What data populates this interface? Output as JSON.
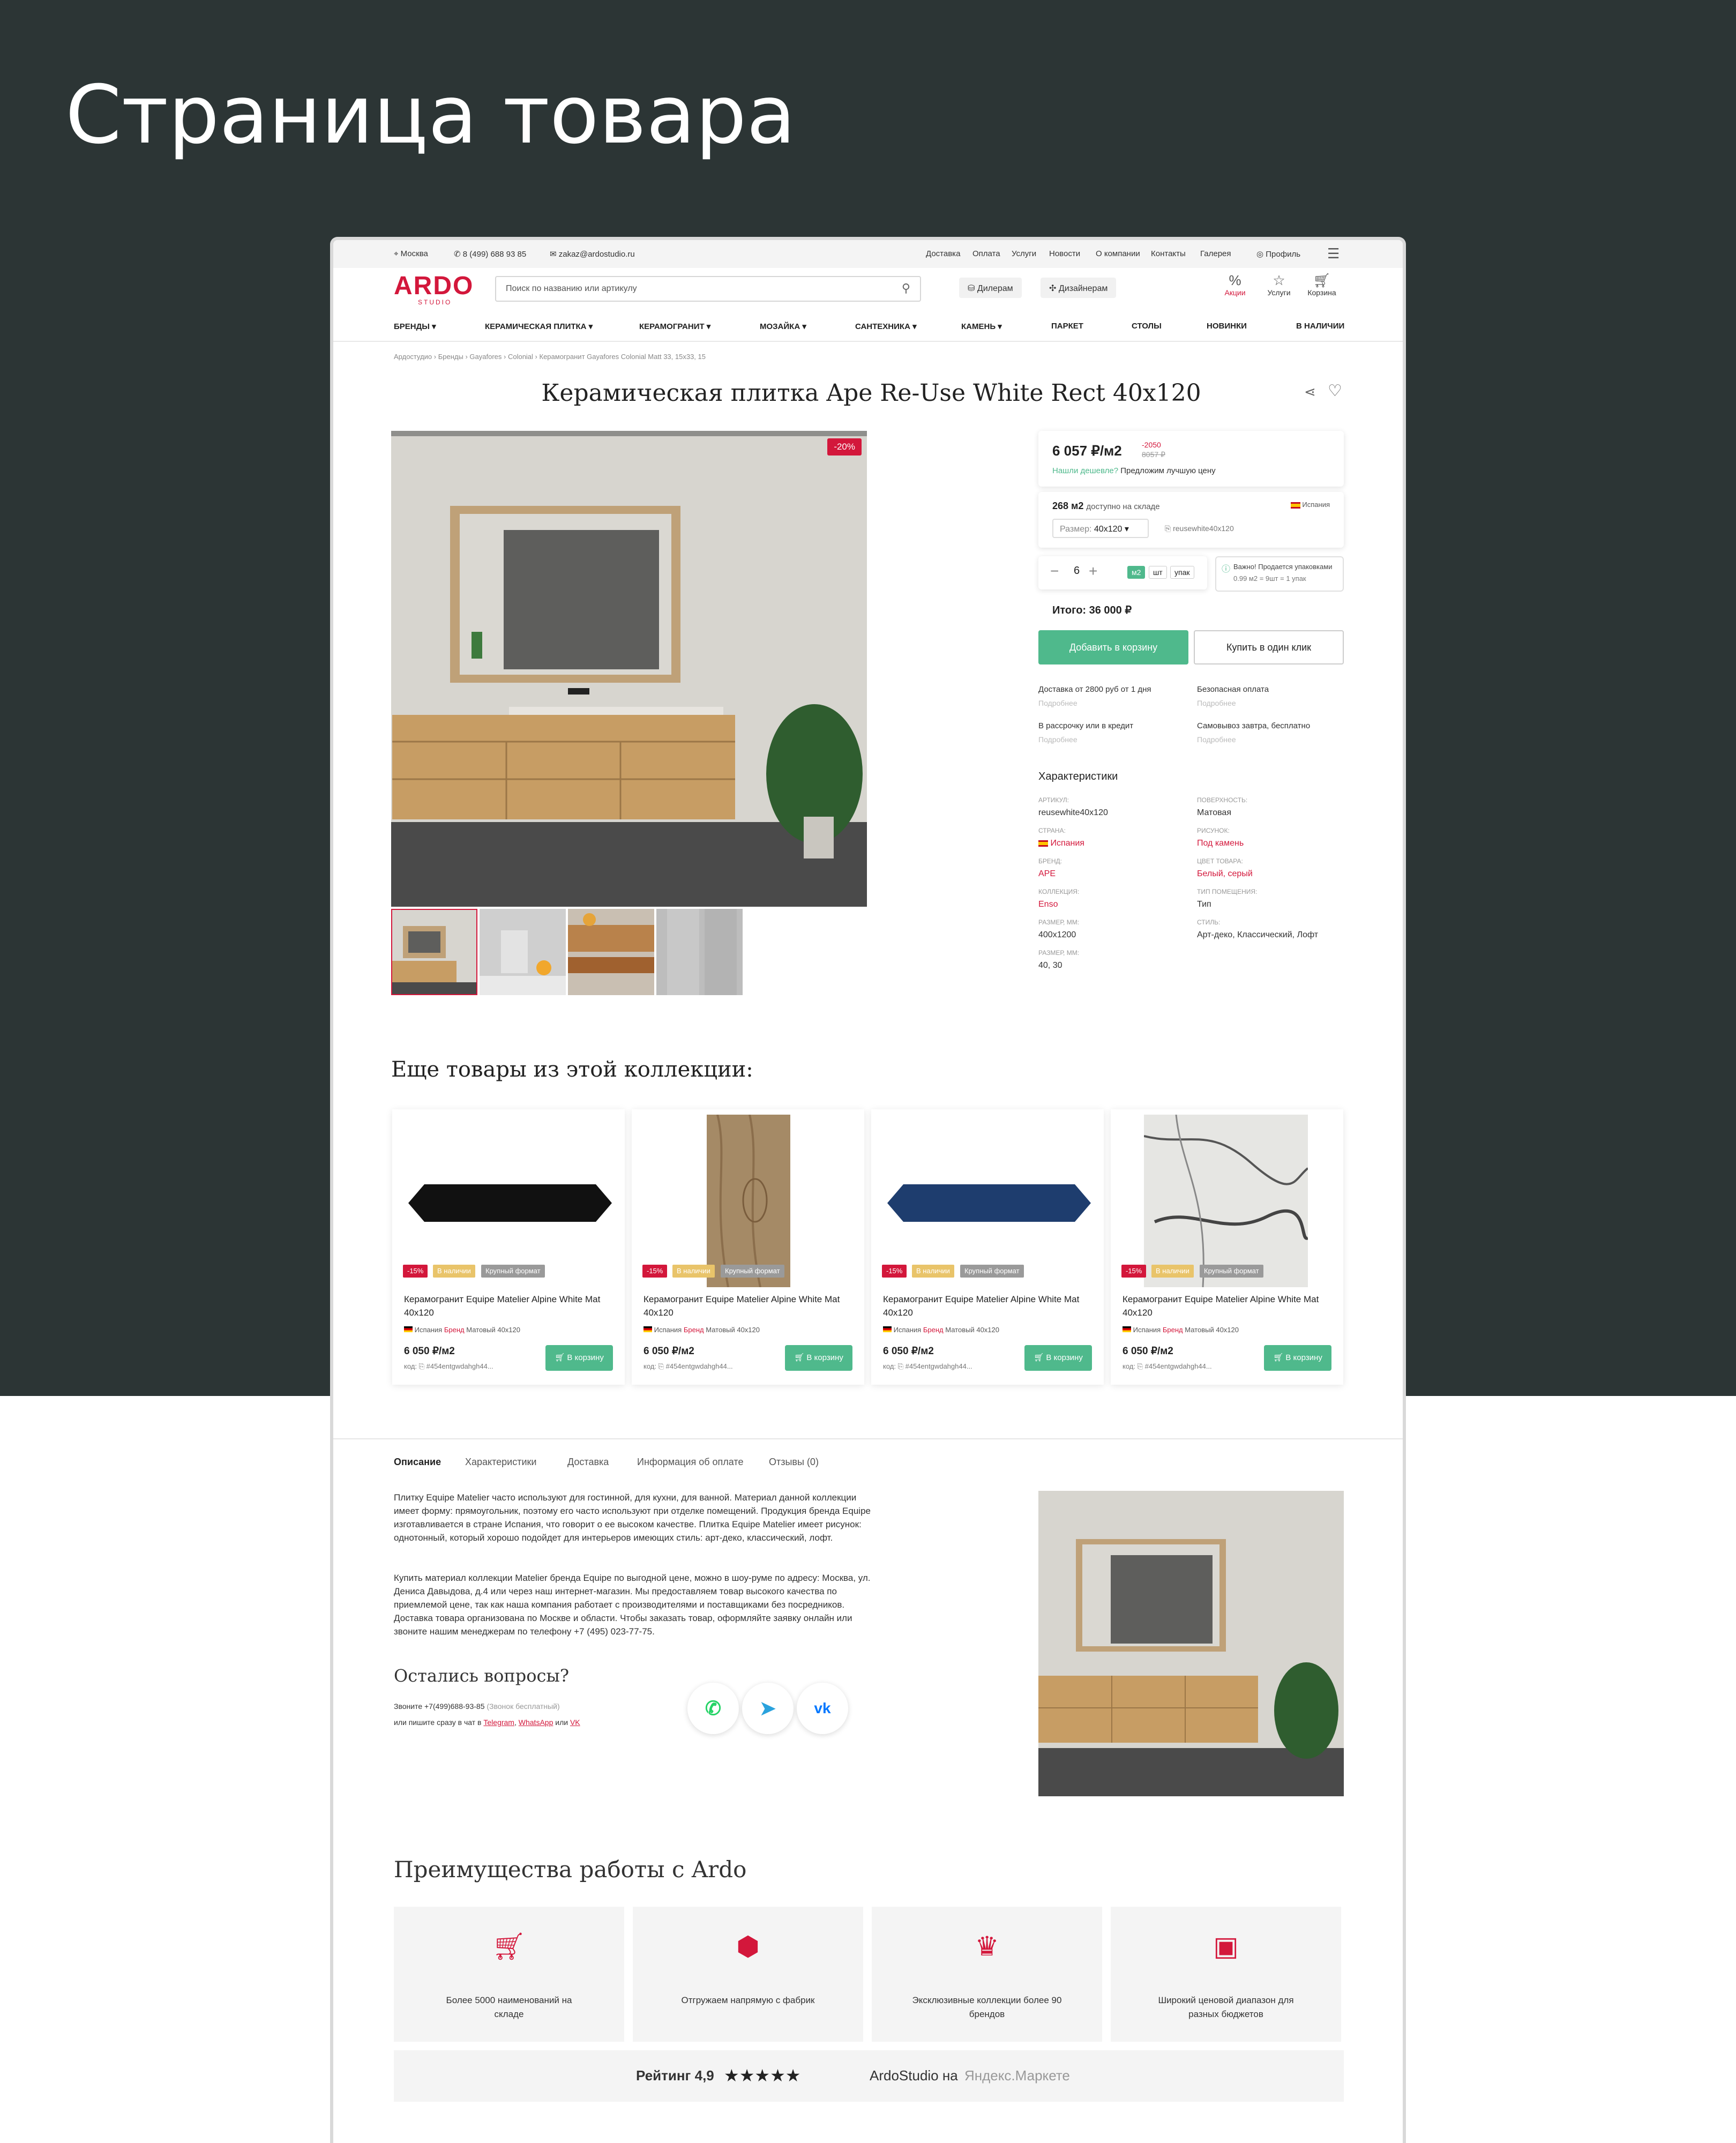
{
  "page_heading": "Страница товара",
  "topbar": {
    "city": "Москва",
    "phone": "8 (499) 688 93 85",
    "email": "zakaz@ardostudio.ru",
    "links": [
      "Доставка",
      "Оплата",
      "Услуги",
      "Новости",
      "О компании",
      "Контакты",
      "Галерея"
    ],
    "profile": "Профиль"
  },
  "header": {
    "logo": "ARDO",
    "logo_sub": "STUDIO",
    "search_placeholder": "Поиск по названию или артикулу",
    "dealers": "Дилерам",
    "designers": "Дизайнерам",
    "icons": [
      {
        "label": "Акции",
        "icon": "percent-icon"
      },
      {
        "label": "Услуги",
        "icon": "star-icon"
      },
      {
        "label": "Корзина",
        "icon": "cart-icon"
      }
    ]
  },
  "nav": [
    "БРЕНДЫ",
    "КЕРАМИЧЕСКАЯ ПЛИТКА",
    "КЕРАМОГРАНИТ",
    "МОЗАЙКА",
    "САНТЕХНИКА",
    "КАМЕНЬ",
    "ПАРКЕТ",
    "СТОЛЫ",
    "НОВИНКИ",
    "В НАЛИЧИИ"
  ],
  "breadcrumb": [
    "Ардостудио",
    "Бренды",
    "Gayafores",
    "Colonial",
    "Керамогранит Gayafores Colonial Matt 33, 15x33, 15"
  ],
  "product": {
    "title": "Керамическая плитка Ape Re-Use White Rect 40x120",
    "discount_badge": "-20%",
    "price": "6 057 ₽/м2",
    "old_discount": "-2050",
    "old_price": "8057 ₽",
    "cheaper_link": "Нашли дешевле?",
    "cheaper_text": "Предложим лучшую цену",
    "stock": "268 м2",
    "stock_text": "доступно на складе",
    "country": "Испания",
    "size_label": "Размер:",
    "size_value": "40x120",
    "sku": "reusewhite40x120",
    "qty": "6",
    "units": [
      "м2",
      "шт",
      "упак"
    ],
    "notice_title": "Важно! Продается упаковками",
    "notice_text": "0.99 м2 = 9шт = 1 упак",
    "total": "Итого: 36 000 ₽",
    "add_to_cart": "Добавить в корзину",
    "buy_one_click": "Купить в один клик",
    "services": [
      {
        "title": "Доставка от 2800 руб от 1 дня",
        "more": "Подробнее"
      },
      {
        "title": "Безопасная оплата",
        "more": "Подробнее"
      },
      {
        "title": "В рассрочку или в кредит",
        "more": "Подробнее"
      },
      {
        "title": "Самовывоз завтра, бесплатно",
        "more": "Подробнее"
      }
    ],
    "specs_title": "Характеристики",
    "specs_left": [
      {
        "label": "АРТИКУЛ:",
        "value": "reusewhite40x120"
      },
      {
        "label": "СТРАНА:",
        "value": "Испания"
      },
      {
        "label": "БРЕНД:",
        "value": "APE"
      },
      {
        "label": "КОЛЛЕКЦИЯ:",
        "value": "Enso"
      },
      {
        "label": "РАЗМЕР, ММ:",
        "value": "400x1200"
      },
      {
        "label": "РАЗМЕР, ММ:",
        "value": "40, 30"
      }
    ],
    "specs_right": [
      {
        "label": "ПОВЕРХНОСТЬ:",
        "value": "Матовая"
      },
      {
        "label": "РИСУНОК:",
        "value": "Под камень"
      },
      {
        "label": "ЦВЕТ ТОВАРА:",
        "value": "Белый, серый"
      },
      {
        "label": "ТИП ПОМЕЩЕНИЯ:",
        "value": "Тип"
      },
      {
        "label": "СТИЛЬ:",
        "value": "Арт-деко, Классический, Лофт"
      }
    ]
  },
  "collection": {
    "title": "Еще товары из этой коллекции:",
    "products": [
      {
        "name": "Керамогранит Equipe Matelier Alpine White Mat 40x120",
        "badges": [
          "-15%",
          "В наличии",
          "Крупный формат"
        ],
        "country": "Испания",
        "brand": "Бренд",
        "surface": "Матовый",
        "size": "40x120",
        "price": "6 050 ₽/м2",
        "code": "код:",
        "code_value": "#454entgwdahgh44...",
        "cart": "В корзину"
      },
      {
        "name": "Керамогранит Equipe Matelier Alpine White Mat 40x120",
        "badges": [
          "-15%",
          "В наличии",
          "Крупный формат"
        ],
        "country": "Испания",
        "brand": "Бренд",
        "surface": "Матовый",
        "size": "40x120",
        "price": "6 050 ₽/м2",
        "code": "код:",
        "code_value": "#454entgwdahgh44...",
        "cart": "В корзину"
      },
      {
        "name": "Керамогранит Equipe Matelier Alpine White Mat 40x120",
        "badges": [
          "-15%",
          "В наличии",
          "Крупный формат"
        ],
        "country": "Испания",
        "brand": "Бренд",
        "surface": "Матовый",
        "size": "40x120",
        "price": "6 050 ₽/м2",
        "code": "код:",
        "code_value": "#454entgwdahgh44...",
        "cart": "В корзину"
      },
      {
        "name": "Керамогранит Equipe Matelier Alpine White Mat 40x120",
        "badges": [
          "-15%",
          "В наличии",
          "Крупный формат"
        ],
        "country": "Испания",
        "brand": "Бренд",
        "surface": "Матовый",
        "size": "40x120",
        "price": "6 050 ₽/м2",
        "code": "код:",
        "code_value": "#454entgwdahgh44...",
        "cart": "В корзину"
      }
    ]
  },
  "tabs": [
    "Описание",
    "Характеристики",
    "Доставка",
    "Информация об оплате",
    "Отзывы (0)"
  ],
  "description": {
    "p1": "Плитку Equipe Matelier часто используют для гостинной, для кухни, для ванной. Материал данной коллекции имеет форму: прямоугольник, поэтому его часто используют при отделке помещений. Продукция бренда Equipe изготавливается в стране Испания, что говорит о ее высоком качестве. Плитка Equipe Matelier имеет рисунок: однотонный, который хорошо подойдет для интерьеров имеющих стиль: арт-деко, классический, лофт.",
    "p2": "Купить материал коллекции Matelier бренда Equipe по выгодной цене, можно в шоу-руме по адресу: Москва, ул. Дениса Давыдова, д.4 или через наш интернет-магазин. Мы предоставляем товар высокого качества по приемлемой цене, так как наша компания работает с производителями и поставщиками без посредников. Доставка товара организована по Москве и области. Чтобы заказать товар, оформляйте заявку онлайн или звоните нашим менеджерам по телефону +7 (495) 023-77-75."
  },
  "questions": {
    "title": "Остались вопросы?",
    "call": "Звоните +7(499)688-93-85",
    "call_note": "(Звонок бесплатный)",
    "chat_prefix": "или пишите сразу в чат в",
    "telegram": "Telegram",
    "whatsapp": "WhatsApp",
    "or": "или",
    "vk": "VK"
  },
  "advantages": {
    "title": "Преимущества работы с Ardo",
    "items": [
      {
        "text": "Более 5000 наименований на складе",
        "icon": "cart-icon"
      },
      {
        "text": "Отгружаем напрямую с фабрик",
        "icon": "box-icon"
      },
      {
        "text": "Эксклюзивные коллекции более 90 брендов",
        "icon": "crown-icon"
      },
      {
        "text": "Широкий ценовой диапазон для разных бюджетов",
        "icon": "wallet-icon"
      }
    ]
  },
  "rating": {
    "label": "Рейтинг 4,9",
    "stars": "★★★★★",
    "store": "ArdoStudio на",
    "market": "Яндекс.Маркете"
  }
}
